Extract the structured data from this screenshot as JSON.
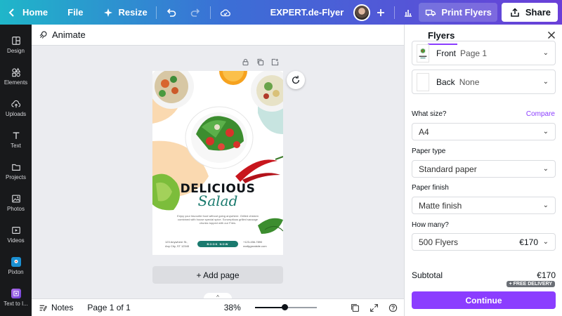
{
  "topbar": {
    "home_label": "Home",
    "file_label": "File",
    "resize_label": "Resize",
    "doc_title": "EXPERT.de-Flyer",
    "print_label": "Print Flyers",
    "share_label": "Share"
  },
  "sidebar": {
    "items": [
      {
        "label": "Design",
        "icon": "design-icon"
      },
      {
        "label": "Elements",
        "icon": "elements-icon"
      },
      {
        "label": "Uploads",
        "icon": "uploads-icon"
      },
      {
        "label": "Text",
        "icon": "text-icon"
      },
      {
        "label": "Projects",
        "icon": "folder-icon"
      },
      {
        "label": "Photos",
        "icon": "photos-icon"
      },
      {
        "label": "Videos",
        "icon": "videos-icon"
      },
      {
        "label": "Pixton",
        "icon": "pixton-app-icon"
      },
      {
        "label": "Text to I...",
        "icon": "text-to-image-app-icon"
      }
    ]
  },
  "editor": {
    "animate_label": "Animate",
    "add_page_label": "+ Add page"
  },
  "flyer": {
    "headline": "DELICIOUS",
    "script_word": "Salad",
    "body_text": "Enjoy your favourite food without going anywhere. Grilled chicken combined with house special spice. Scrumptious grilled sausage chunks topped with our Fries.",
    "address_line1": "123 Anywhere St.,",
    "address_line2": "Any City, ST 12345",
    "cta_label": "BOOK NOW",
    "phone": "+123-456-7890",
    "email": "reallygreatsite.com"
  },
  "bottombar": {
    "notes_label": "Notes",
    "page_indicator": "Page 1 of 1",
    "zoom_label": "38%",
    "zoom_slider_fraction": 0.48
  },
  "panel": {
    "title": "Flyers",
    "front_label": "Front",
    "front_value": "Page 1",
    "back_label": "Back",
    "back_value": "None",
    "size_label": "What size?",
    "compare_label": "Compare",
    "size_value": "A4",
    "paper_type_label": "Paper type",
    "paper_type_value": "Standard paper",
    "paper_finish_label": "Paper finish",
    "paper_finish_value": "Matte finish",
    "quantity_label": "How many?",
    "quantity_value": "500 Flyers",
    "quantity_price": "€170",
    "subtotal_label": "Subtotal",
    "subtotal_value": "€170",
    "delivery_badge": "+ FREE DELIVERY",
    "continue_label": "Continue"
  },
  "colors": {
    "accent": "#8b3dff",
    "sidebar_bg": "#18191b",
    "flyer_green": "#1a7a6e",
    "flyer_peach": "#fad9b0",
    "flyer_teal": "#c7e4e0"
  }
}
